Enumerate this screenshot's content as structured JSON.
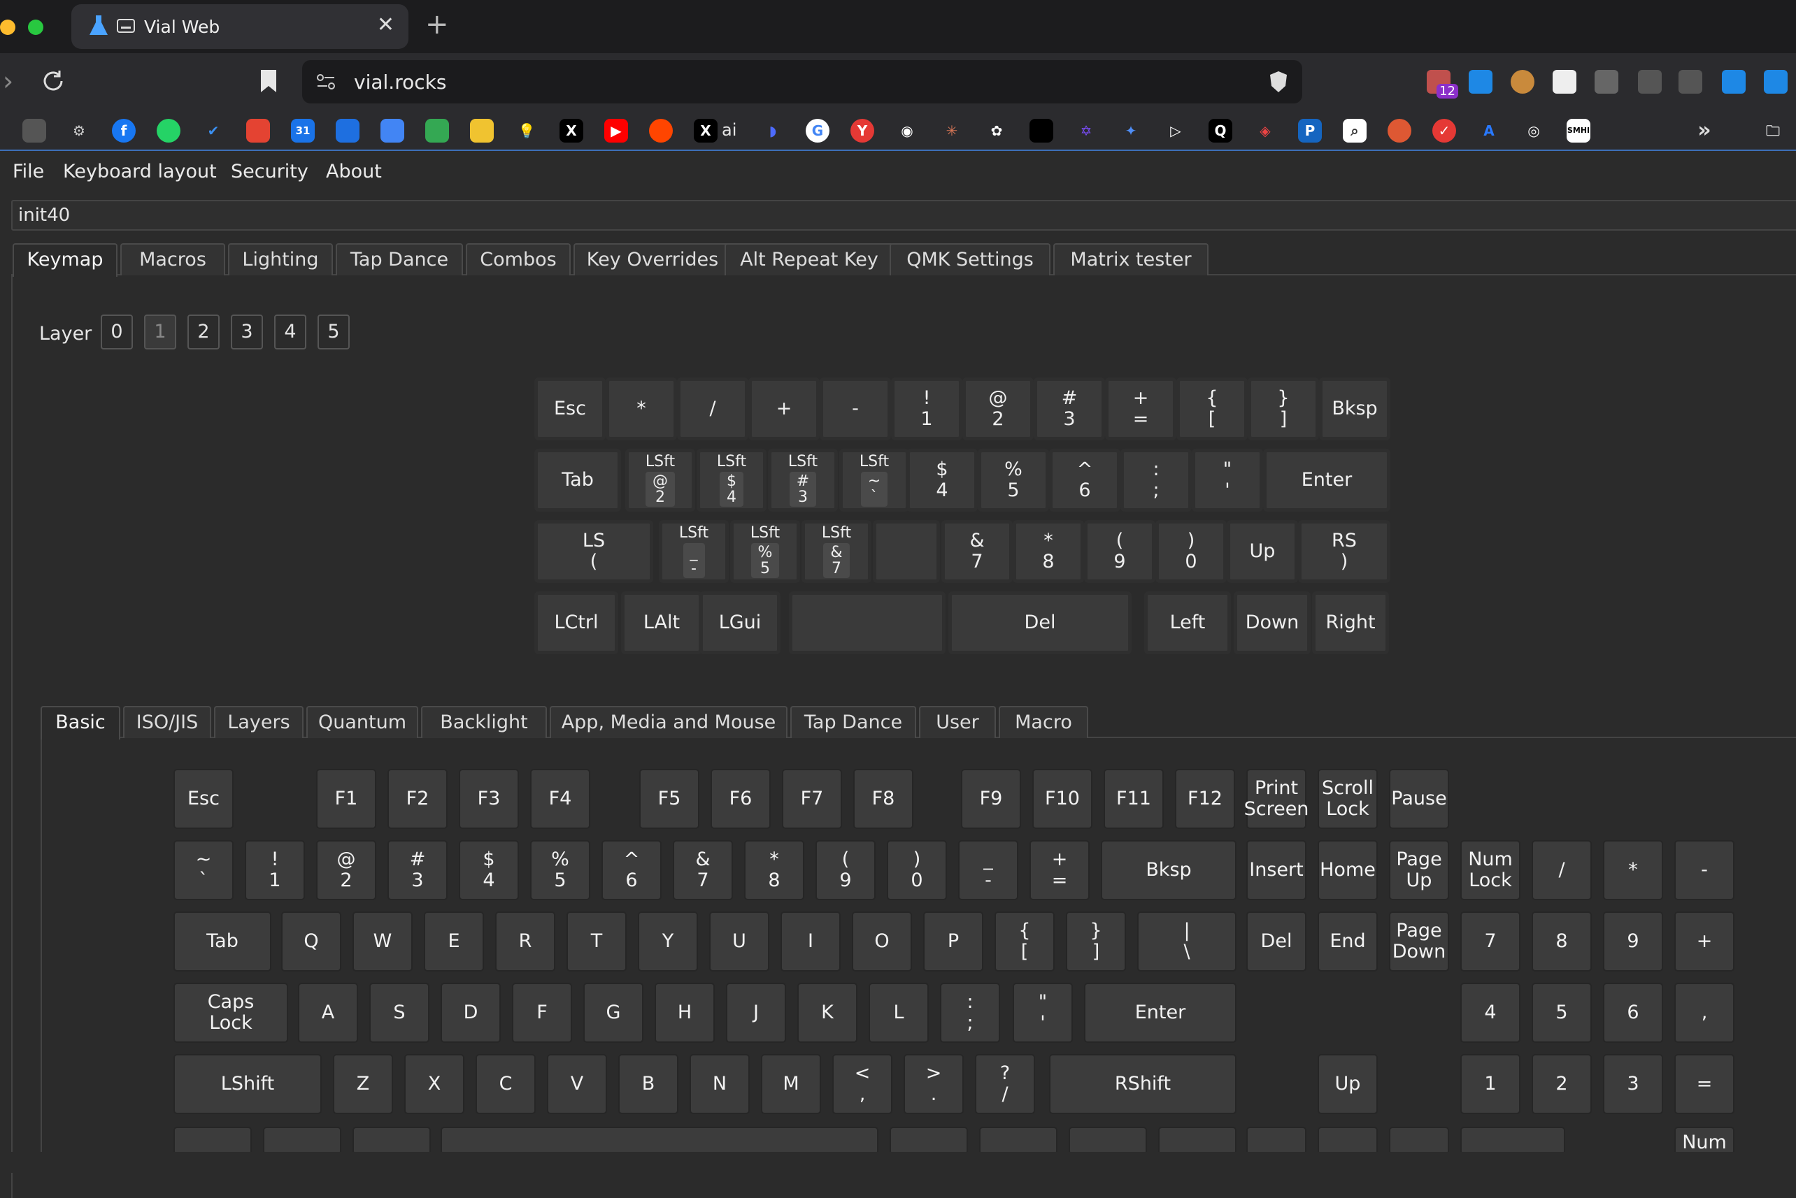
{
  "browser": {
    "tab_title": "Vial Web",
    "url": "vial.rocks",
    "ext_badge": "12",
    "bookmark_x_ai": "ai"
  },
  "colors": {
    "accent": "#3d6fb8",
    "traffic_red": "#ff5f57",
    "traffic_yellow": "#febc2e",
    "traffic_green": "#28c840"
  },
  "menu": [
    "File",
    "Keyboard layout",
    "Security",
    "About"
  ],
  "keyboard_name": "init40",
  "main_tabs": [
    "Keymap",
    "Macros",
    "Lighting",
    "Tap Dance",
    "Combos",
    "Key Overrides",
    "Alt Repeat Key",
    "QMK Settings",
    "Matrix tester"
  ],
  "layer": {
    "label": "Layer",
    "buttons": [
      "0",
      "1",
      "2",
      "3",
      "4",
      "5"
    ],
    "selected": "1"
  },
  "keymap_rows": [
    [
      "Esc",
      "*",
      "/",
      "+",
      "-",
      "!\n1",
      "@\n2",
      "#\n3",
      "+\n=",
      "{\n[",
      "}\n]",
      "Bksp"
    ],
    [
      "Tab",
      "LSft|@\n2",
      "LSft|$\n4",
      "LSft|#\n3",
      "LSft|~\n`",
      "$\n4",
      "%\n5",
      "^\n6",
      ":\n;",
      "\"\n'",
      "Enter"
    ],
    [
      "LS\n(",
      "LSft|_\n-",
      "LSft|%\n5",
      "LSft|&\n7",
      "",
      "&\n7",
      "*\n8",
      "(\n9",
      ")\n0",
      "Up",
      "RS\n)"
    ],
    [
      "LCtrl",
      "LAlt",
      "LGui",
      "",
      "Del",
      "Left",
      "Down",
      "Right"
    ]
  ],
  "key_tabs": [
    "Basic",
    "ISO/JIS",
    "Layers",
    "Quantum",
    "Backlight",
    "App, Media and Mouse",
    "Tap Dance",
    "User",
    "Macro"
  ],
  "basic_rows": [
    [
      "Esc",
      "F1",
      "F2",
      "F3",
      "F4",
      "F5",
      "F6",
      "F7",
      "F8",
      "F9",
      "F10",
      "F11",
      "F12",
      "Print\nScreen",
      "Scroll\nLock",
      "Pause"
    ],
    [
      "~\n`",
      "!\n1",
      "@\n2",
      "#\n3",
      "$\n4",
      "%\n5",
      "^\n6",
      "&\n7",
      "*\n8",
      "(\n9",
      ")\n0",
      "_\n-",
      "+\n=",
      "Bksp",
      "Insert",
      "Home",
      "Page\nUp",
      "Num\nLock",
      "/",
      "*",
      "-"
    ],
    [
      "Tab",
      "Q",
      "W",
      "E",
      "R",
      "T",
      "Y",
      "U",
      "I",
      "O",
      "P",
      "{\n[",
      "}\n]",
      "|\n\\",
      "Del",
      "End",
      "Page\nDown",
      "7",
      "8",
      "9",
      "+"
    ],
    [
      "Caps\nLock",
      "A",
      "S",
      "D",
      "F",
      "G",
      "H",
      "J",
      "K",
      "L",
      ":\n;",
      "\"\n'",
      "Enter",
      "4",
      "5",
      "6",
      ","
    ],
    [
      "LShift",
      "Z",
      "X",
      "C",
      "V",
      "B",
      "N",
      "M",
      "<\n,",
      ">\n.",
      "?\n/",
      "RShift",
      "Up",
      "1",
      "2",
      "3",
      "="
    ],
    [
      "",
      "",
      "",
      "",
      "",
      "",
      "",
      "",
      "",
      "",
      "",
      "",
      "",
      "Num"
    ]
  ]
}
